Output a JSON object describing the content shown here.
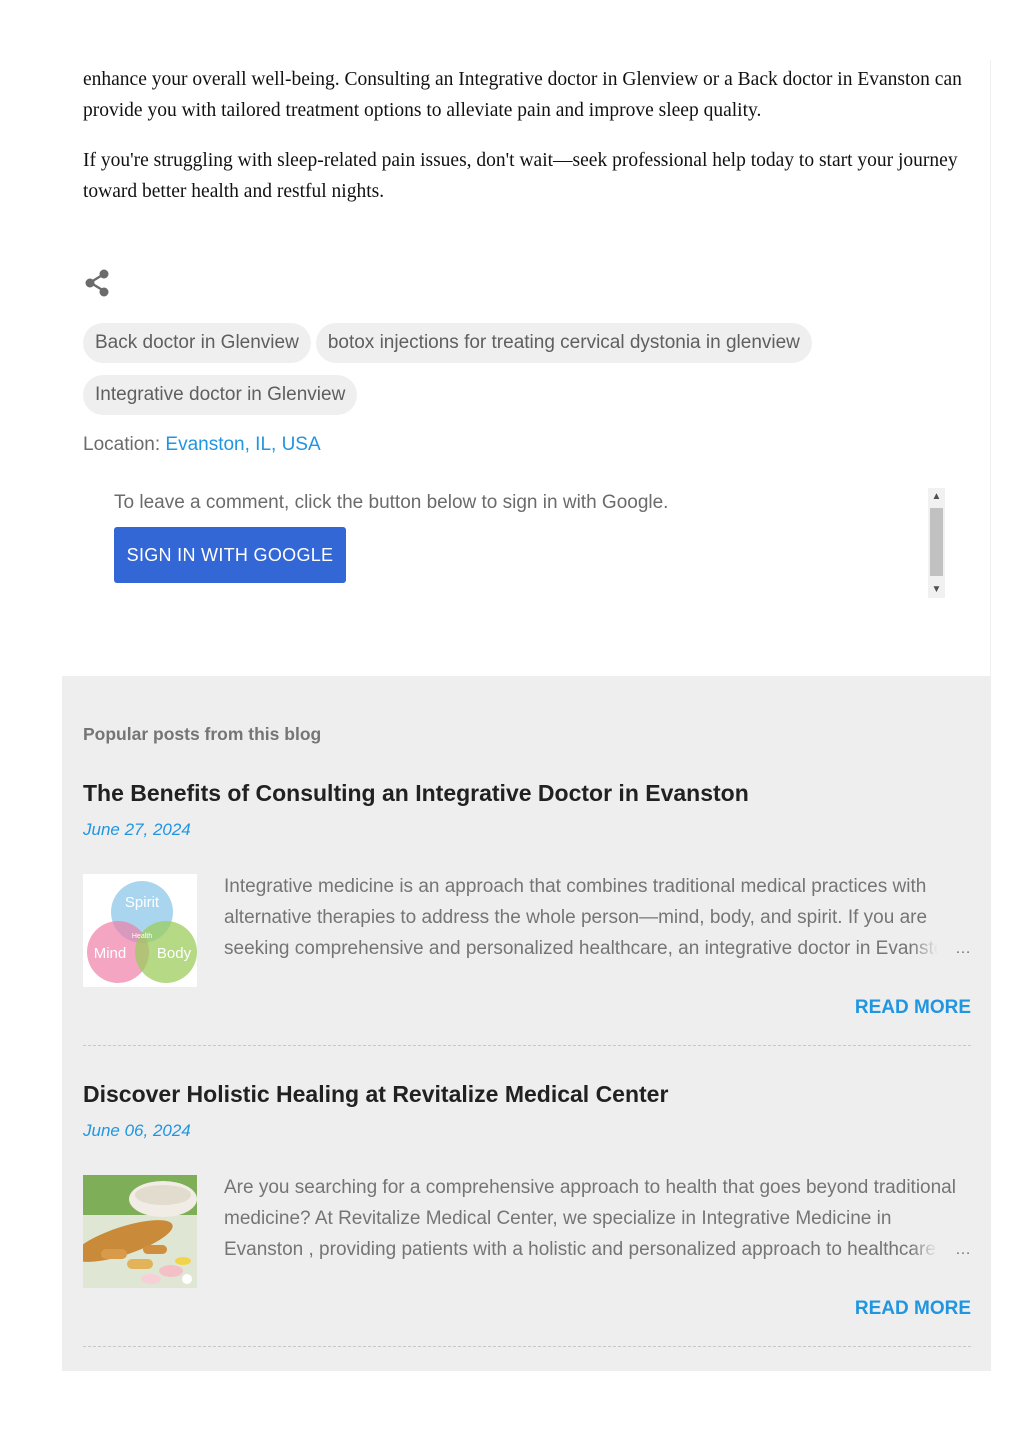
{
  "post": {
    "paragraphs": [
      "enhance your overall well-being. Consulting an Integrative doctor in Glenview or a Back doctor in Evanston can provide you with tailored treatment options to alleviate pain and improve sleep quality.",
      "If you're struggling with sleep-related pain issues, don't wait—seek professional help today to start your journey toward better health and restful nights."
    ],
    "share_icon": "share-icon"
  },
  "labels": [
    "Back doctor in Glenview",
    "botox injections for treating cervical dystonia in glenview",
    "Integrative doctor in Glenview"
  ],
  "location": {
    "label": "Location:",
    "value": "Evanston, IL, USA"
  },
  "comments": {
    "prompt": "To leave a comment, click the button below to sign in with Google.",
    "button_label": "Sign in with Google"
  },
  "popular": {
    "heading": "Popular posts from this blog",
    "posts": [
      {
        "title": "The Benefits of Consulting an Integrative Doctor in Evanston",
        "date": "June 27, 2024",
        "snippet": "Integrative medicine is an approach that combines traditional medical practices with alternative therapies to address the whole person—mind, body, and spirit. If you are seeking comprehensive and personalized healthcare, an integrative doctor in Evanston",
        "ellipsis": "…",
        "read_more": "READ MORE",
        "thumb": {
          "spirit": "Spirit",
          "health": "Health",
          "mind": "Mind",
          "body": "Body"
        }
      },
      {
        "title": "Discover Holistic Healing at Revitalize Medical Center",
        "date": "June 06, 2024",
        "snippet": "Are you searching for a comprehensive approach to health that goes beyond traditional medicine? At Revitalize Medical Center, we specialize in Integrative Medicine in Evanston , providing patients with a holistic and personalized approach to healthcare",
        "ellipsis": "…",
        "read_more": "READ MORE"
      }
    ]
  },
  "colors": {
    "link": "#2196e0",
    "button": "#3367d6",
    "panel_bg": "#eeeeee",
    "chip_bg": "#efefef"
  }
}
